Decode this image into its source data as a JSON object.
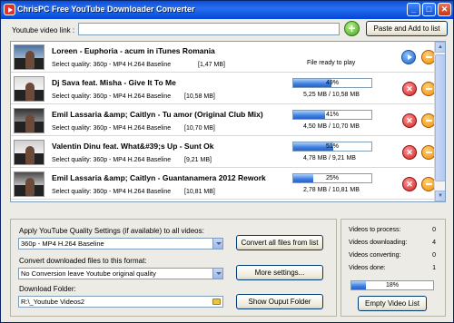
{
  "window": {
    "title": "ChrisPC Free YouTube Downloader Converter",
    "min_label": "_",
    "max_label": "□",
    "close_label": "✕"
  },
  "link": {
    "label": "Youtube video link :",
    "value": "",
    "add_label": "+",
    "paste_button": "Paste and Add to list"
  },
  "videos": [
    {
      "title": "Loreen - Euphoria - acum in iTunes Romania",
      "quality": "Select quality:  360p - MP4 H.264 Baseline",
      "size": "[1,47 MB]",
      "status": "File ready to play",
      "progress": null,
      "progress_label": "",
      "sizes": ""
    },
    {
      "title": "Dj Sava feat. Misha - Give It To Me",
      "quality": "Select quality:  360p - MP4 H.264 Baseline",
      "size": "[10,58 MB]",
      "status": "",
      "progress": 49,
      "progress_label": "49%",
      "sizes": "5,25 MB / 10,58 MB"
    },
    {
      "title": "Emil Lassaria &amp; Caitlyn - Tu amor (Original Club Mix)",
      "quality": "Select quality:  360p - MP4 H.264 Baseline",
      "size": "[10,70 MB]",
      "status": "",
      "progress": 41,
      "progress_label": "41%",
      "sizes": "4,50 MB / 10,70 MB"
    },
    {
      "title": "Valentin Dinu feat. What&#39;s Up - Sunt Ok",
      "quality": "Select quality:  360p - MP4 H.264 Baseline",
      "size": "[9,21 MB]",
      "status": "",
      "progress": 51,
      "progress_label": "51%",
      "sizes": "4,78 MB / 9,21 MB"
    },
    {
      "title": "Emil Lassaria &amp; Caitlyn - Guantanamera 2012 Rework",
      "quality": "Select quality:  360p - MP4 H.264 Baseline",
      "size": "[10,81 MB]",
      "status": "",
      "progress": 25,
      "progress_label": "25%",
      "sizes": "2,78 MB / 10,81 MB"
    }
  ],
  "settings": {
    "quality_label": "Apply YouTube Quality Settings (if available) to all videos:",
    "quality_value": "360p - MP4 H.264 Baseline",
    "convert_all_button": "Convert all files from list",
    "format_label": "Convert downloaded files to this format:",
    "format_value": "No Conversion leave Youtube original quality",
    "more_settings_button": "More settings...",
    "folder_label": "Download Folder:",
    "folder_value": "R:\\_Youtube Videos2",
    "show_folder_button": "Show Ouput Folder"
  },
  "stats": {
    "to_process_label": "Videos to process:",
    "to_process": "0",
    "downloading_label": "Videos downloading:",
    "downloading": "4",
    "converting_label": "Videos converting:",
    "converting": "0",
    "done_label": "Videos done:",
    "done": "1",
    "total_progress": 18,
    "total_progress_label": "18%",
    "empty_button": "Empty Video List"
  },
  "colors": {
    "titlebar": "#0a4ed8",
    "progress": "#3d7ee0",
    "cancel": "#d11e1e",
    "remove": "#f08a00",
    "play": "#1c5fc7",
    "add": "#3fa81d"
  }
}
